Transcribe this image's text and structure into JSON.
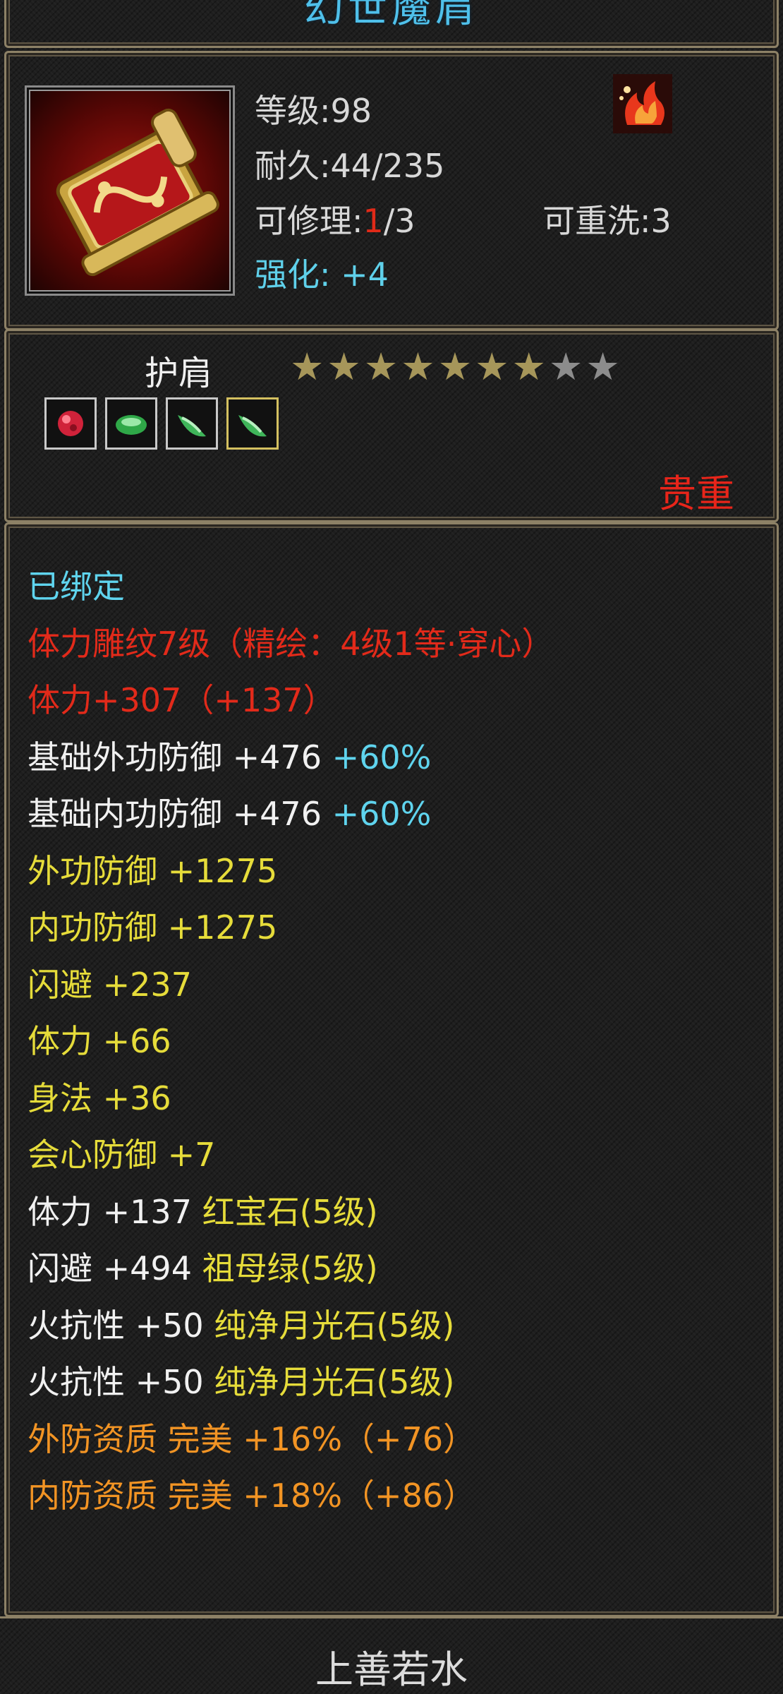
{
  "item": {
    "name": "幻世魔肩",
    "level_label": "等级:98",
    "durability_label": "耐久:44/235",
    "repair_prefix": "可修理:",
    "repair_current": "1",
    "repair_total": "/3",
    "rewash_label": "可重洗:3",
    "enhance_label": "强化: +4",
    "icon": "shoulder-armor-icon",
    "badge_icon": "flame-badge-icon"
  },
  "slot": {
    "type": "护肩",
    "stars_total": 9,
    "stars_lit": 7,
    "gems": [
      "ruby",
      "emerald",
      "jade",
      "jade"
    ],
    "rarity": "贵重"
  },
  "attributes": [
    {
      "text": "已绑定",
      "color": "cyan"
    },
    {
      "text": "体力雕纹7级（精绘：4级1等·穿心）",
      "color": "red"
    },
    {
      "text": "体力+307（+137）",
      "color": "red"
    },
    {
      "text": "基础外功防御 +476 ",
      "extra": "+60%",
      "color": "white"
    },
    {
      "text": "基础内功防御 +476 ",
      "extra": "+60%",
      "color": "white"
    },
    {
      "text": "外功防御 +1275",
      "color": "yellow"
    },
    {
      "text": "内功防御 +1275",
      "color": "yellow"
    },
    {
      "text": "闪避 +237",
      "color": "yellow"
    },
    {
      "text": "体力 +66",
      "color": "yellow"
    },
    {
      "text": "身法 +36",
      "color": "yellow"
    },
    {
      "text": "会心防御 +7",
      "color": "yellow"
    },
    {
      "text": "体力 +137 ",
      "extra": "红宝石(5级)",
      "color": "white",
      "extra_color": "yellow"
    },
    {
      "text": "闪避 +494 ",
      "extra": "祖母绿(5级)",
      "color": "white",
      "extra_color": "yellow"
    },
    {
      "text": "火抗性 +50 ",
      "extra": "纯净月光石(5级)",
      "color": "white",
      "extra_color": "yellow"
    },
    {
      "text": "火抗性 +50 ",
      "extra": "纯净月光石(5级)",
      "color": "white",
      "extra_color": "yellow"
    },
    {
      "text": "外防资质  完美 +16%（+76）",
      "color": "orange"
    },
    {
      "text": "内防资质  完美 +18%（+86）",
      "color": "orange"
    }
  ],
  "footer": {
    "owner": "上善若水"
  },
  "colors": {
    "cyan": "#5fd4ee",
    "red": "#e22a1a",
    "yellow": "#e6dc3a",
    "orange": "#f29424",
    "white": "#f1f1f1"
  }
}
